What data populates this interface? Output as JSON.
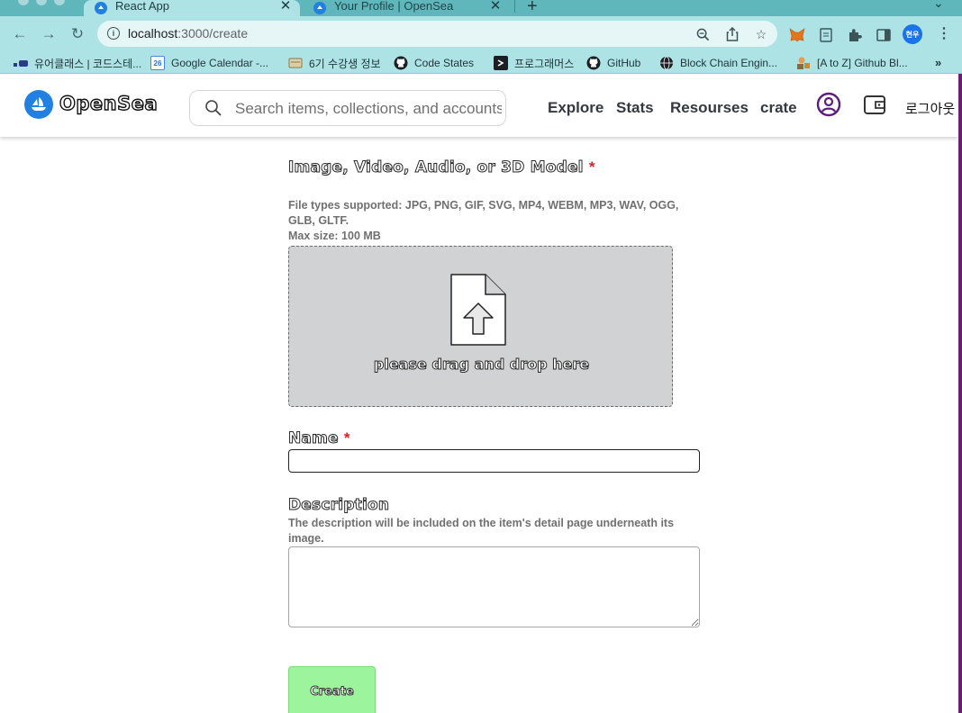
{
  "browser": {
    "tabs": [
      {
        "title": "React App",
        "active": true
      },
      {
        "title": "Your Profile | OpenSea",
        "active": false
      }
    ],
    "url": {
      "host": "localhost",
      "path": ":3000/create"
    },
    "profile_badge": "현우",
    "bookmarks": [
      {
        "label": "유어클래스 | 코드스테...",
        "icon": "codestates-icon"
      },
      {
        "label": "Google Calendar -...",
        "icon": "calendar-icon"
      },
      {
        "label": "6기 수강생 정보",
        "icon": "notepad-icon"
      },
      {
        "label": "Code States",
        "icon": "github-icon"
      },
      {
        "label": "프로그래머스",
        "icon": "programmers-icon"
      },
      {
        "label": "GitHub",
        "icon": "github-icon"
      },
      {
        "label": "Block Chain Engin...",
        "icon": "globe-icon"
      },
      {
        "label": "[A to Z] Github Bl...",
        "icon": "blog-icon"
      }
    ],
    "bookmarks_more": "»"
  },
  "header": {
    "logo_text": "OpenSea",
    "search_placeholder": "Search items, collections, and accounts",
    "nav": [
      "Explore",
      "Stats",
      "Resourses",
      "crate"
    ],
    "logout": "로그아웃"
  },
  "form": {
    "media_label": "Image, Video, Audio, or 3D Model",
    "required_mark": "*",
    "file_types": "File types supported: JPG, PNG, GIF, SVG, MP4, WEBM, MP3, WAV, OGG, GLB, GLTF.",
    "max_size": "Max size: 100 MB",
    "dropzone_text": "please drag and drop here",
    "name_label": "Name",
    "name_value": "",
    "description_label": "Description",
    "description_help": "The description will be included on the item's detail page underneath its image.",
    "description_value": "",
    "create_button": "Create"
  },
  "colors": {
    "brand": "#2081e2",
    "create_button": "#9cf59c",
    "required": "#e02020",
    "chrome": "#aee3e6"
  }
}
